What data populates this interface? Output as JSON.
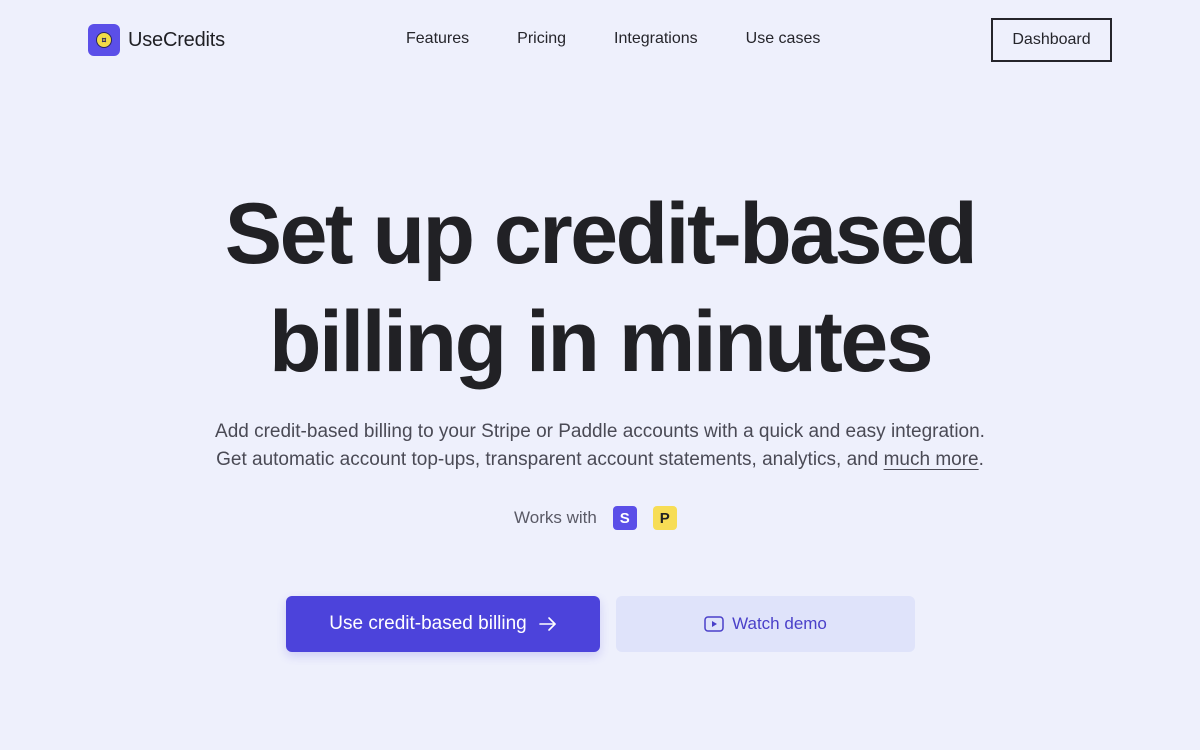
{
  "nav": {
    "logo_text": "UseCredits",
    "logo_icon": "coin-icon",
    "links": [
      {
        "label": "Features"
      },
      {
        "label": "Pricing"
      },
      {
        "label": "Integrations"
      },
      {
        "label": "Use cases"
      }
    ],
    "dashboard_label": "Dashboard"
  },
  "hero": {
    "title_line1": "Set up credit-based",
    "title_line2": "billing in minutes",
    "subtitle_line1": "Add credit-based billing to your Stripe or Paddle accounts with a quick and easy integration.",
    "subtitle_line2_prefix": "Get automatic account top-ups, transparent account statements, analytics, and ",
    "subtitle_link": "much more",
    "subtitle_suffix": ".",
    "works_with_label": "Works with",
    "integrations": [
      {
        "name": "Stripe",
        "glyph": "S",
        "color": "#5b4fe8"
      },
      {
        "name": "Paddle",
        "glyph": "P",
        "color": "#f7dd55"
      }
    ],
    "primary_cta": "Use credit-based billing",
    "primary_cta_icon": "arrow-right-icon",
    "secondary_cta": "Watch demo",
    "secondary_cta_icon": "play-video-icon"
  },
  "colors": {
    "background": "#eef0fc",
    "accent": "#4c43db",
    "secondary_bg": "#dfe3fa"
  }
}
